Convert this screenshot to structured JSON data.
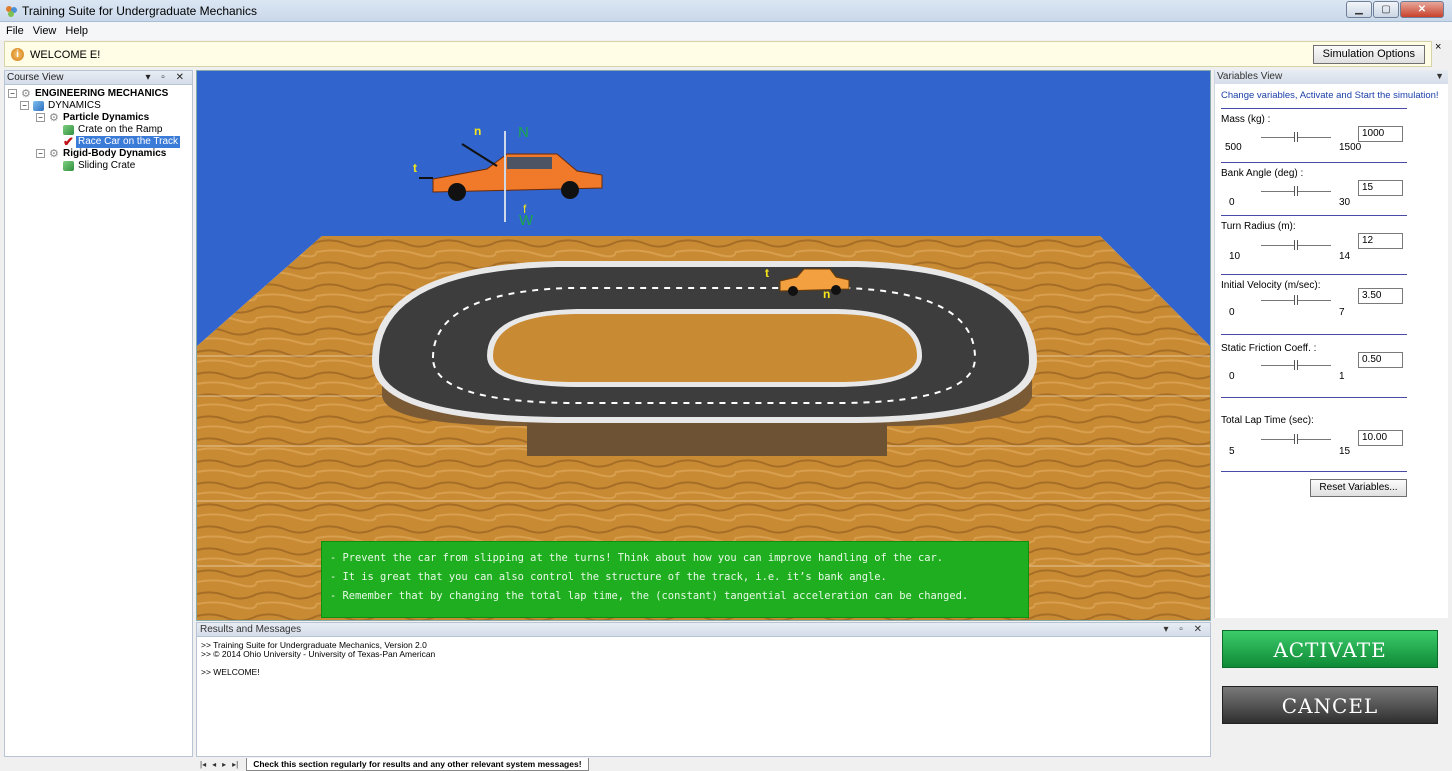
{
  "window": {
    "title": "Training Suite for Undergraduate Mechanics",
    "controls": [
      "minimize",
      "maximize",
      "close"
    ]
  },
  "menu": [
    "File",
    "View",
    "Help"
  ],
  "infobar": {
    "message": "WELCOME E!",
    "options_button": "Simulation Options",
    "close": "×"
  },
  "course_view": {
    "title": "Course View",
    "tree": {
      "root": "ENGINEERING MECHANICS",
      "dynamics": "DYNAMICS",
      "particle": "Particle Dynamics",
      "crate_ramp": "Crate on the Ramp",
      "race_car": "Race Car on the Track",
      "rigid": "Rigid-Body Dynamics",
      "sliding_crate": "Sliding Crate"
    }
  },
  "scene": {
    "labels": {
      "n_top": "n",
      "N_top": "N",
      "t_top": "t",
      "f_top": "f",
      "W_top": "W",
      "t_track": "t",
      "n_track": "n"
    },
    "hints": [
      "- Prevent the car from slipping at the turns! Think about how you can improve handling of the car.",
      "- It is great that you can also control the structure of the track, i.e. it’s bank angle.",
      "- Remember that by changing the total lap time, the (constant) tangential acceleration can be changed."
    ]
  },
  "variables_view": {
    "title": "Variables View",
    "intro": "Change variables, Activate and Start the simulation!",
    "variables": [
      {
        "label": "Mass (kg) :",
        "min": "500",
        "max": "1500",
        "value": "1000",
        "level": 0.5
      },
      {
        "label": "Bank Angle (deg) :",
        "min": "0",
        "max": "30",
        "value": "15",
        "level": 0.5
      },
      {
        "label": "Turn Radius (m):",
        "min": "10",
        "max": "14",
        "value": "12",
        "level": 0.5
      },
      {
        "label": "Initial Velocity (m/sec):",
        "min": "0",
        "max": "7",
        "value": "3.50",
        "level": 0.5
      },
      {
        "label": "Static Friction Coeff. :",
        "min": "0",
        "max": "1",
        "value": "0.50",
        "level": 0.5
      },
      {
        "label": "Total Lap Time (sec):",
        "min": "5",
        "max": "15",
        "value": "10.00",
        "level": 0.5
      }
    ],
    "reset_button": "Reset Variables..."
  },
  "buttons": {
    "activate": "ACTIVATE",
    "cancel": "CANCEL"
  },
  "results": {
    "title": "Results and Messages",
    "lines": [
      ">> Training Suite for Undergraduate Mechanics,  Version 2.0",
      ">> © 2014 Ohio University - University of Texas-Pan American",
      "",
      ">> WELCOME!"
    ],
    "tab": "Check this section regularly for results and any other relevant system messages!",
    "nav": [
      "|◂",
      "◂",
      "▸",
      "▸|"
    ]
  },
  "colors": {
    "sky": "#3164cc",
    "hint_bg": "#1fae1f",
    "activate": "#13943c",
    "cancel": "#3a3a3a",
    "car": "#f07a2a"
  }
}
